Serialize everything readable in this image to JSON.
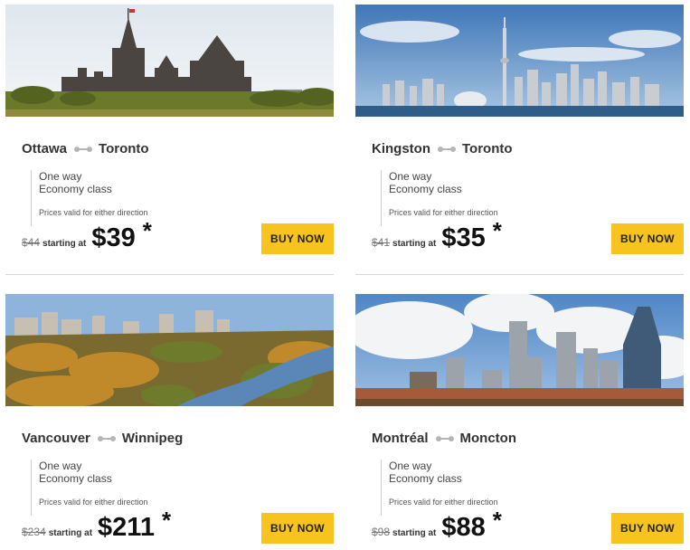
{
  "deals": [
    {
      "from": "Ottawa",
      "to": "Toronto",
      "trip_type": "One way",
      "cabin": "Economy class",
      "note": "Prices valid for either direction",
      "old_price": "$44",
      "starting_label": "starting at",
      "price": "$39",
      "asterisk": "*",
      "button": "BUY NOW"
    },
    {
      "from": "Kingston",
      "to": "Toronto",
      "trip_type": "One way",
      "cabin": "Economy class",
      "note": "Prices valid for either direction",
      "old_price": "$41",
      "starting_label": "starting at",
      "price": "$35",
      "asterisk": "*",
      "button": "BUY NOW"
    },
    {
      "from": "Vancouver",
      "to": "Winnipeg",
      "trip_type": "One way",
      "cabin": "Economy class",
      "note": "Prices valid for either direction",
      "old_price": "$234",
      "starting_label": "starting at",
      "price": "$211",
      "asterisk": "*",
      "button": "BUY NOW"
    },
    {
      "from": "Montréal",
      "to": "Moncton",
      "trip_type": "One way",
      "cabin": "Economy class",
      "note": "Prices valid for either direction",
      "old_price": "$98",
      "starting_label": "starting at",
      "price": "$88",
      "asterisk": "*",
      "button": "BUY NOW"
    }
  ],
  "colors": {
    "button": "#f7c31f",
    "divider": "#d8d8d8",
    "route_icon": "#b5b5b5"
  }
}
